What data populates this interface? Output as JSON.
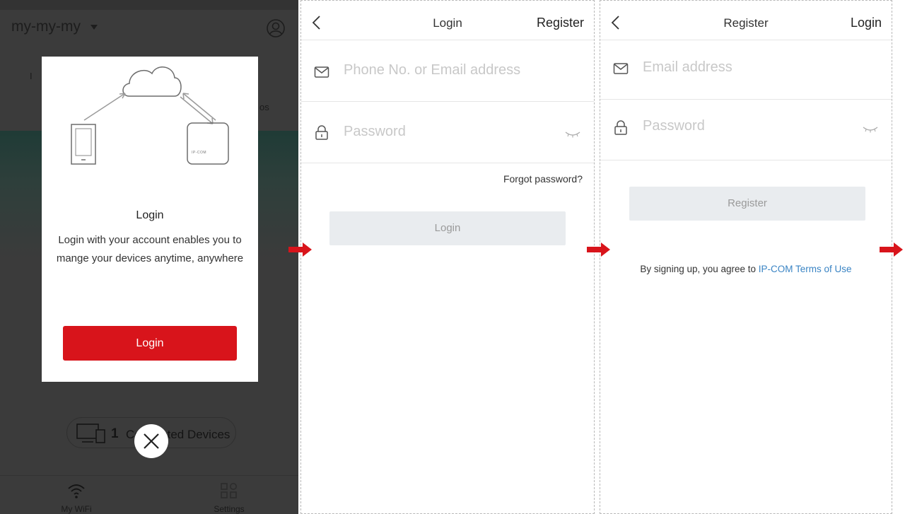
{
  "home": {
    "network_name": "my-my-my",
    "bg_fragment_1": "I",
    "bg_fragment_2": "os",
    "devices_count": "1",
    "devices_label": "Connected Devices",
    "tabs": [
      {
        "label": "My WiFi"
      },
      {
        "label": "Settings"
      }
    ],
    "modal": {
      "title": "Login",
      "body": "Login with your account enables you to mange your devices anytime, anywhere",
      "button": "Login",
      "router_brand": "IP-COM"
    }
  },
  "login_screen": {
    "title": "Login",
    "action": "Register",
    "email_placeholder": "Phone No. or Email address",
    "password_placeholder": "Password",
    "forgot": "Forgot password?",
    "button": "Login"
  },
  "register_screen": {
    "title": "Register",
    "action": "Login",
    "email_placeholder": "Email address",
    "password_placeholder": "Password",
    "button": "Register",
    "terms_prefix": "By signing up, you agree to ",
    "terms_link": "IP-COM Terms of Use"
  },
  "colors": {
    "accent_red": "#d8141b",
    "link_blue": "#3a84c4",
    "disabled_button": "#e9ecef",
    "overlay": "#3b3b3b"
  }
}
